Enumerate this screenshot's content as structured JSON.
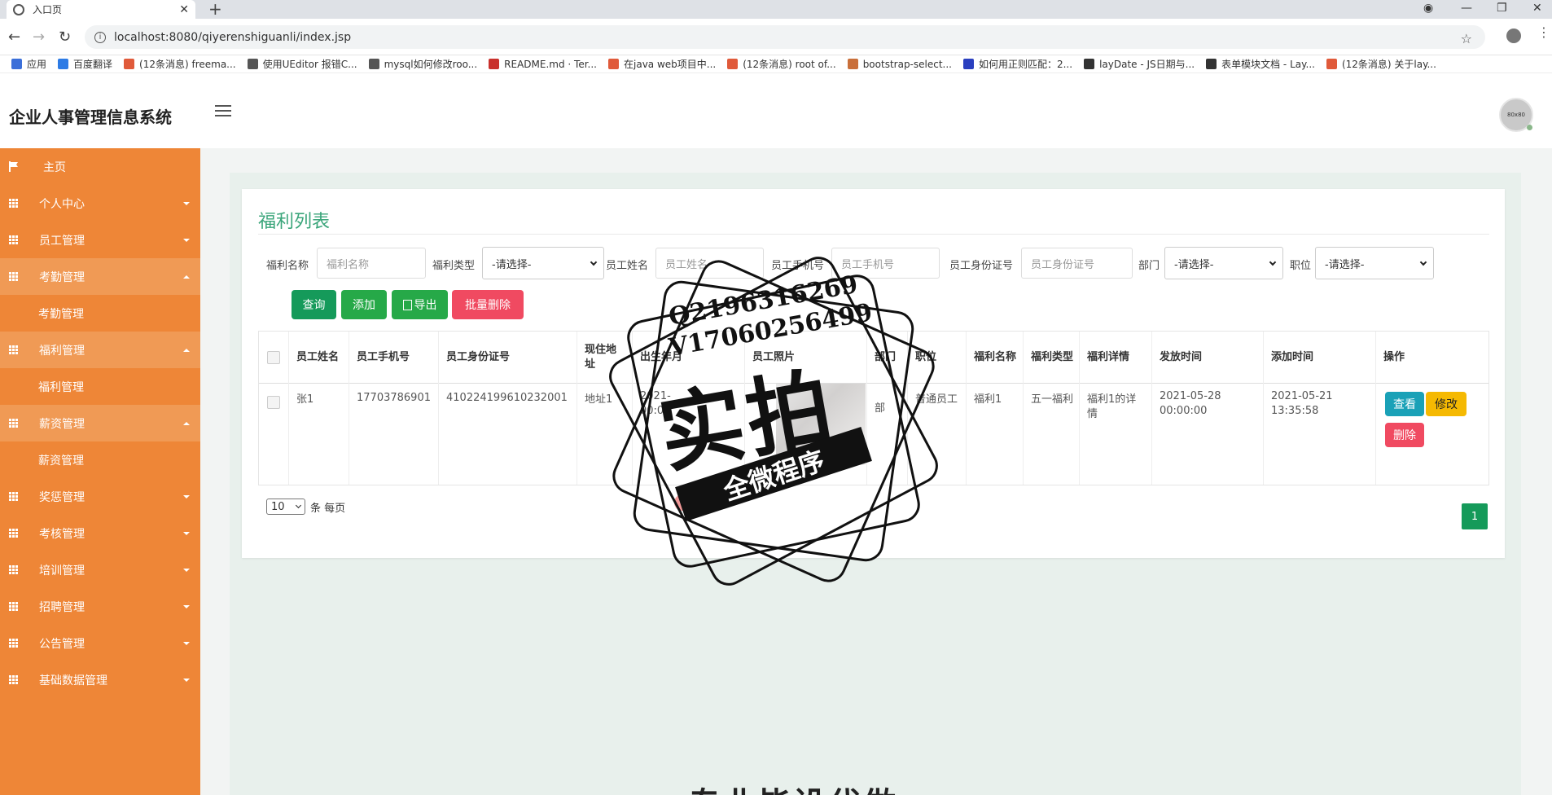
{
  "browser": {
    "tab_title": "入口页",
    "url": "localhost:8080/qiyerenshiguanli/index.jsp",
    "bookmarks": [
      {
        "label": "应用",
        "color": "#3b6fd9"
      },
      {
        "label": "百度翻译",
        "color": "#2d7be5"
      },
      {
        "label": "(12条消息) freema...",
        "color": "#e05a3a"
      },
      {
        "label": "使用UEditor 报错C...",
        "color": "#555555"
      },
      {
        "label": "mysql如何修改roo...",
        "color": "#555555"
      },
      {
        "label": "README.md · Ter...",
        "color": "#c9302c"
      },
      {
        "label": "在java web项目中...",
        "color": "#e05a3a"
      },
      {
        "label": "(12条消息) root of...",
        "color": "#e05a3a"
      },
      {
        "label": "bootstrap-select...",
        "color": "#c96f3a"
      },
      {
        "label": "如何用正则匹配：2...",
        "color": "#2a3fbf"
      },
      {
        "label": "layDate - JS日期与...",
        "color": "#333333"
      },
      {
        "label": "表单模块文档 - Lay...",
        "color": "#333333"
      },
      {
        "label": "(12条消息) 关于lay...",
        "color": "#e05a3a"
      }
    ]
  },
  "app": {
    "title": "企业人事管理信息系统",
    "avatar_text": "80x80"
  },
  "sidebar": {
    "items": [
      {
        "label": "主页",
        "type": "home"
      },
      {
        "label": "个人中心",
        "type": "menu",
        "open": false
      },
      {
        "label": "员工管理",
        "type": "menu",
        "open": false
      },
      {
        "label": "考勤管理",
        "type": "menu",
        "open": true
      },
      {
        "label": "考勤管理",
        "type": "sub"
      },
      {
        "label": "福利管理",
        "type": "menu",
        "open": true
      },
      {
        "label": "福利管理",
        "type": "sub"
      },
      {
        "label": "薪资管理",
        "type": "menu",
        "open": true
      },
      {
        "label": "薪资管理",
        "type": "sub"
      },
      {
        "label": "奖惩管理",
        "type": "menu",
        "open": false
      },
      {
        "label": "考核管理",
        "type": "menu",
        "open": false
      },
      {
        "label": "培训管理",
        "type": "menu",
        "open": false
      },
      {
        "label": "招聘管理",
        "type": "menu",
        "open": false
      },
      {
        "label": "公告管理",
        "type": "menu",
        "open": false
      },
      {
        "label": "基础数据管理",
        "type": "menu",
        "open": false
      }
    ]
  },
  "panel": {
    "title": "福利列表",
    "filters": {
      "welfare_name_label": "福利名称",
      "welfare_name_placeholder": "福利名称",
      "welfare_type_label": "福利类型",
      "welfare_type_value": "-请选择-",
      "emp_name_label": "员工姓名",
      "emp_name_placeholder": "员工姓名",
      "emp_phone_label": "员工手机号",
      "emp_phone_placeholder": "员工手机号",
      "emp_id_label": "员工身份证号",
      "emp_id_placeholder": "员工身份证号",
      "dept_label": "部门",
      "dept_value": "-请选择-",
      "position_label": "职位",
      "position_value": "-请选择-"
    },
    "buttons": {
      "query": "查询",
      "add": "添加",
      "export": "导出",
      "batch_delete": "批量删除"
    },
    "table": {
      "columns": [
        "员工姓名",
        "员工手机号",
        "员工身份证号",
        "现住地址",
        "出生年月",
        "员工照片",
        "部门",
        "职位",
        "福利名称",
        "福利类型",
        "福利详情",
        "发放时间",
        "添加时间",
        "操作"
      ],
      "rows": [
        {
          "name": "张1",
          "phone": "17703786901",
          "id_card": "410224199610232001",
          "address": "地址1",
          "birth": "2021-\n00:00",
          "dept": "部",
          "position": "普通员工",
          "welfare_name": "福利1",
          "welfare_type": "五一福利",
          "welfare_detail": "福利1的详情",
          "issue_time": "2021-05-28\n00:00:00",
          "add_time": "2021-05-21\n13:35:58"
        }
      ],
      "actions": {
        "view": "查看",
        "edit": "修改",
        "delete": "删除"
      }
    },
    "pagination": {
      "page_size": "10",
      "per_page_label": "条 每页",
      "current_page": "1"
    }
  },
  "watermark": {
    "line1": "Q2196316269",
    "line2": "V17060256499",
    "big": "实拍",
    "band": "全微程序"
  },
  "bottom_text": "专业毕设代做"
}
